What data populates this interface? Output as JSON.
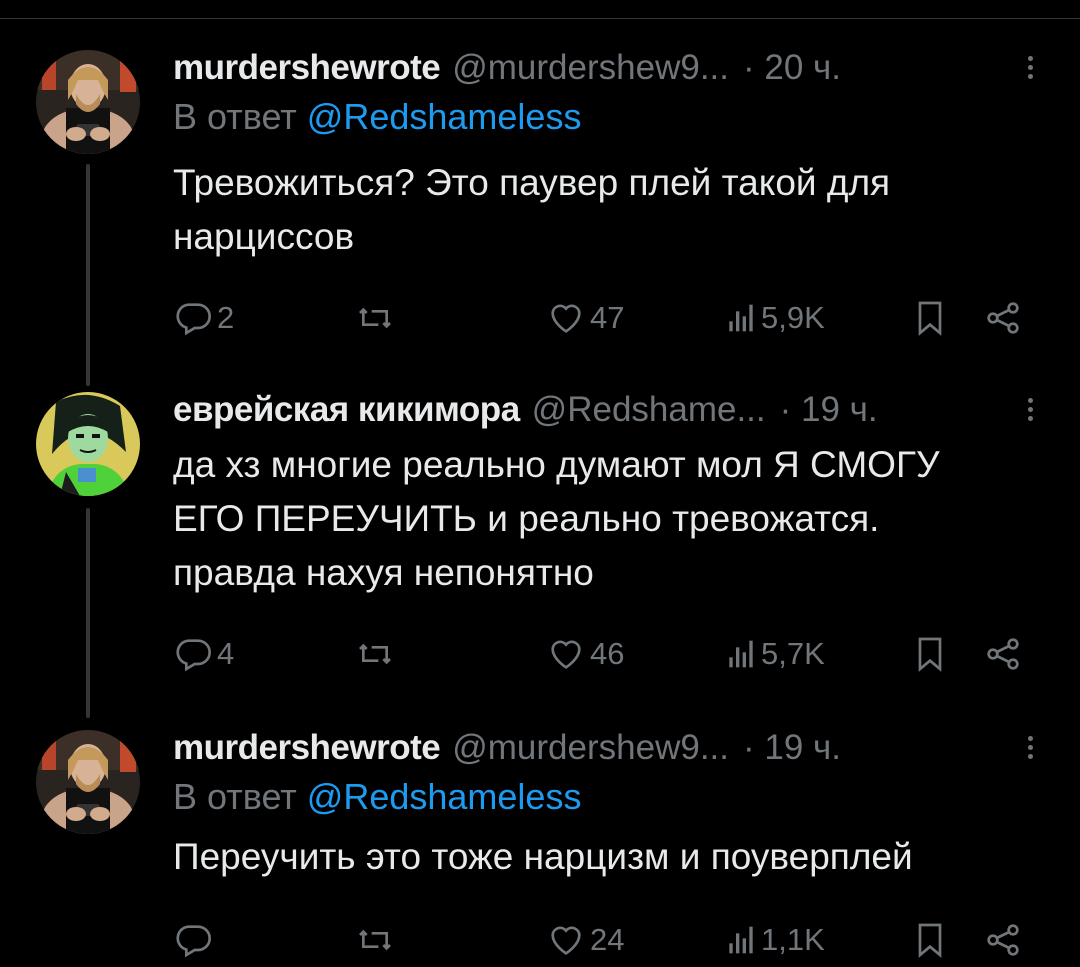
{
  "tweets": [
    {
      "name": "murdershewrote",
      "handle": "@murdershew9...",
      "time": "· 20 ч.",
      "reply_prefix": "В ответ",
      "reply_mention": "@Redshameless",
      "text_lines": [
        "Тревожиться? Это паувер плей такой для",
        "нарциссов"
      ],
      "replies": "2",
      "retweets": "",
      "likes": "47",
      "views": "5,9K",
      "avatar": "avatar-man-icon"
    },
    {
      "name": "еврейская кикимора",
      "handle": "@Redshame...",
      "time": "· 19 ч.",
      "text_lines": [
        "да хз многие реально думают мол Я СМОГУ",
        "ЕГО ПЕРЕУЧИТЬ и реально тревожатся.",
        "правда нахуя непонятно"
      ],
      "replies": "4",
      "retweets": "",
      "likes": "46",
      "views": "5,7K",
      "avatar": "avatar-cartoon-icon"
    },
    {
      "name": "murdershewrote",
      "handle": "@murdershew9...",
      "time": "· 19 ч.",
      "reply_prefix": "В ответ",
      "reply_mention": "@Redshameless",
      "text_lines": [
        "Переучить это тоже нарцизм и поуверплей"
      ],
      "replies": "",
      "retweets": "",
      "likes": "24",
      "views": "1,1K",
      "avatar": "avatar-man-icon"
    }
  ],
  "colors": {
    "background": "#000000",
    "text": "#e7e9ea",
    "secondary": "#71767b",
    "link": "#1d9bf0",
    "thread_line": "#333639"
  },
  "icons": [
    "reply-icon",
    "retweet-icon",
    "like-icon",
    "views-icon",
    "bookmark-icon",
    "share-icon",
    "more-icon"
  ]
}
